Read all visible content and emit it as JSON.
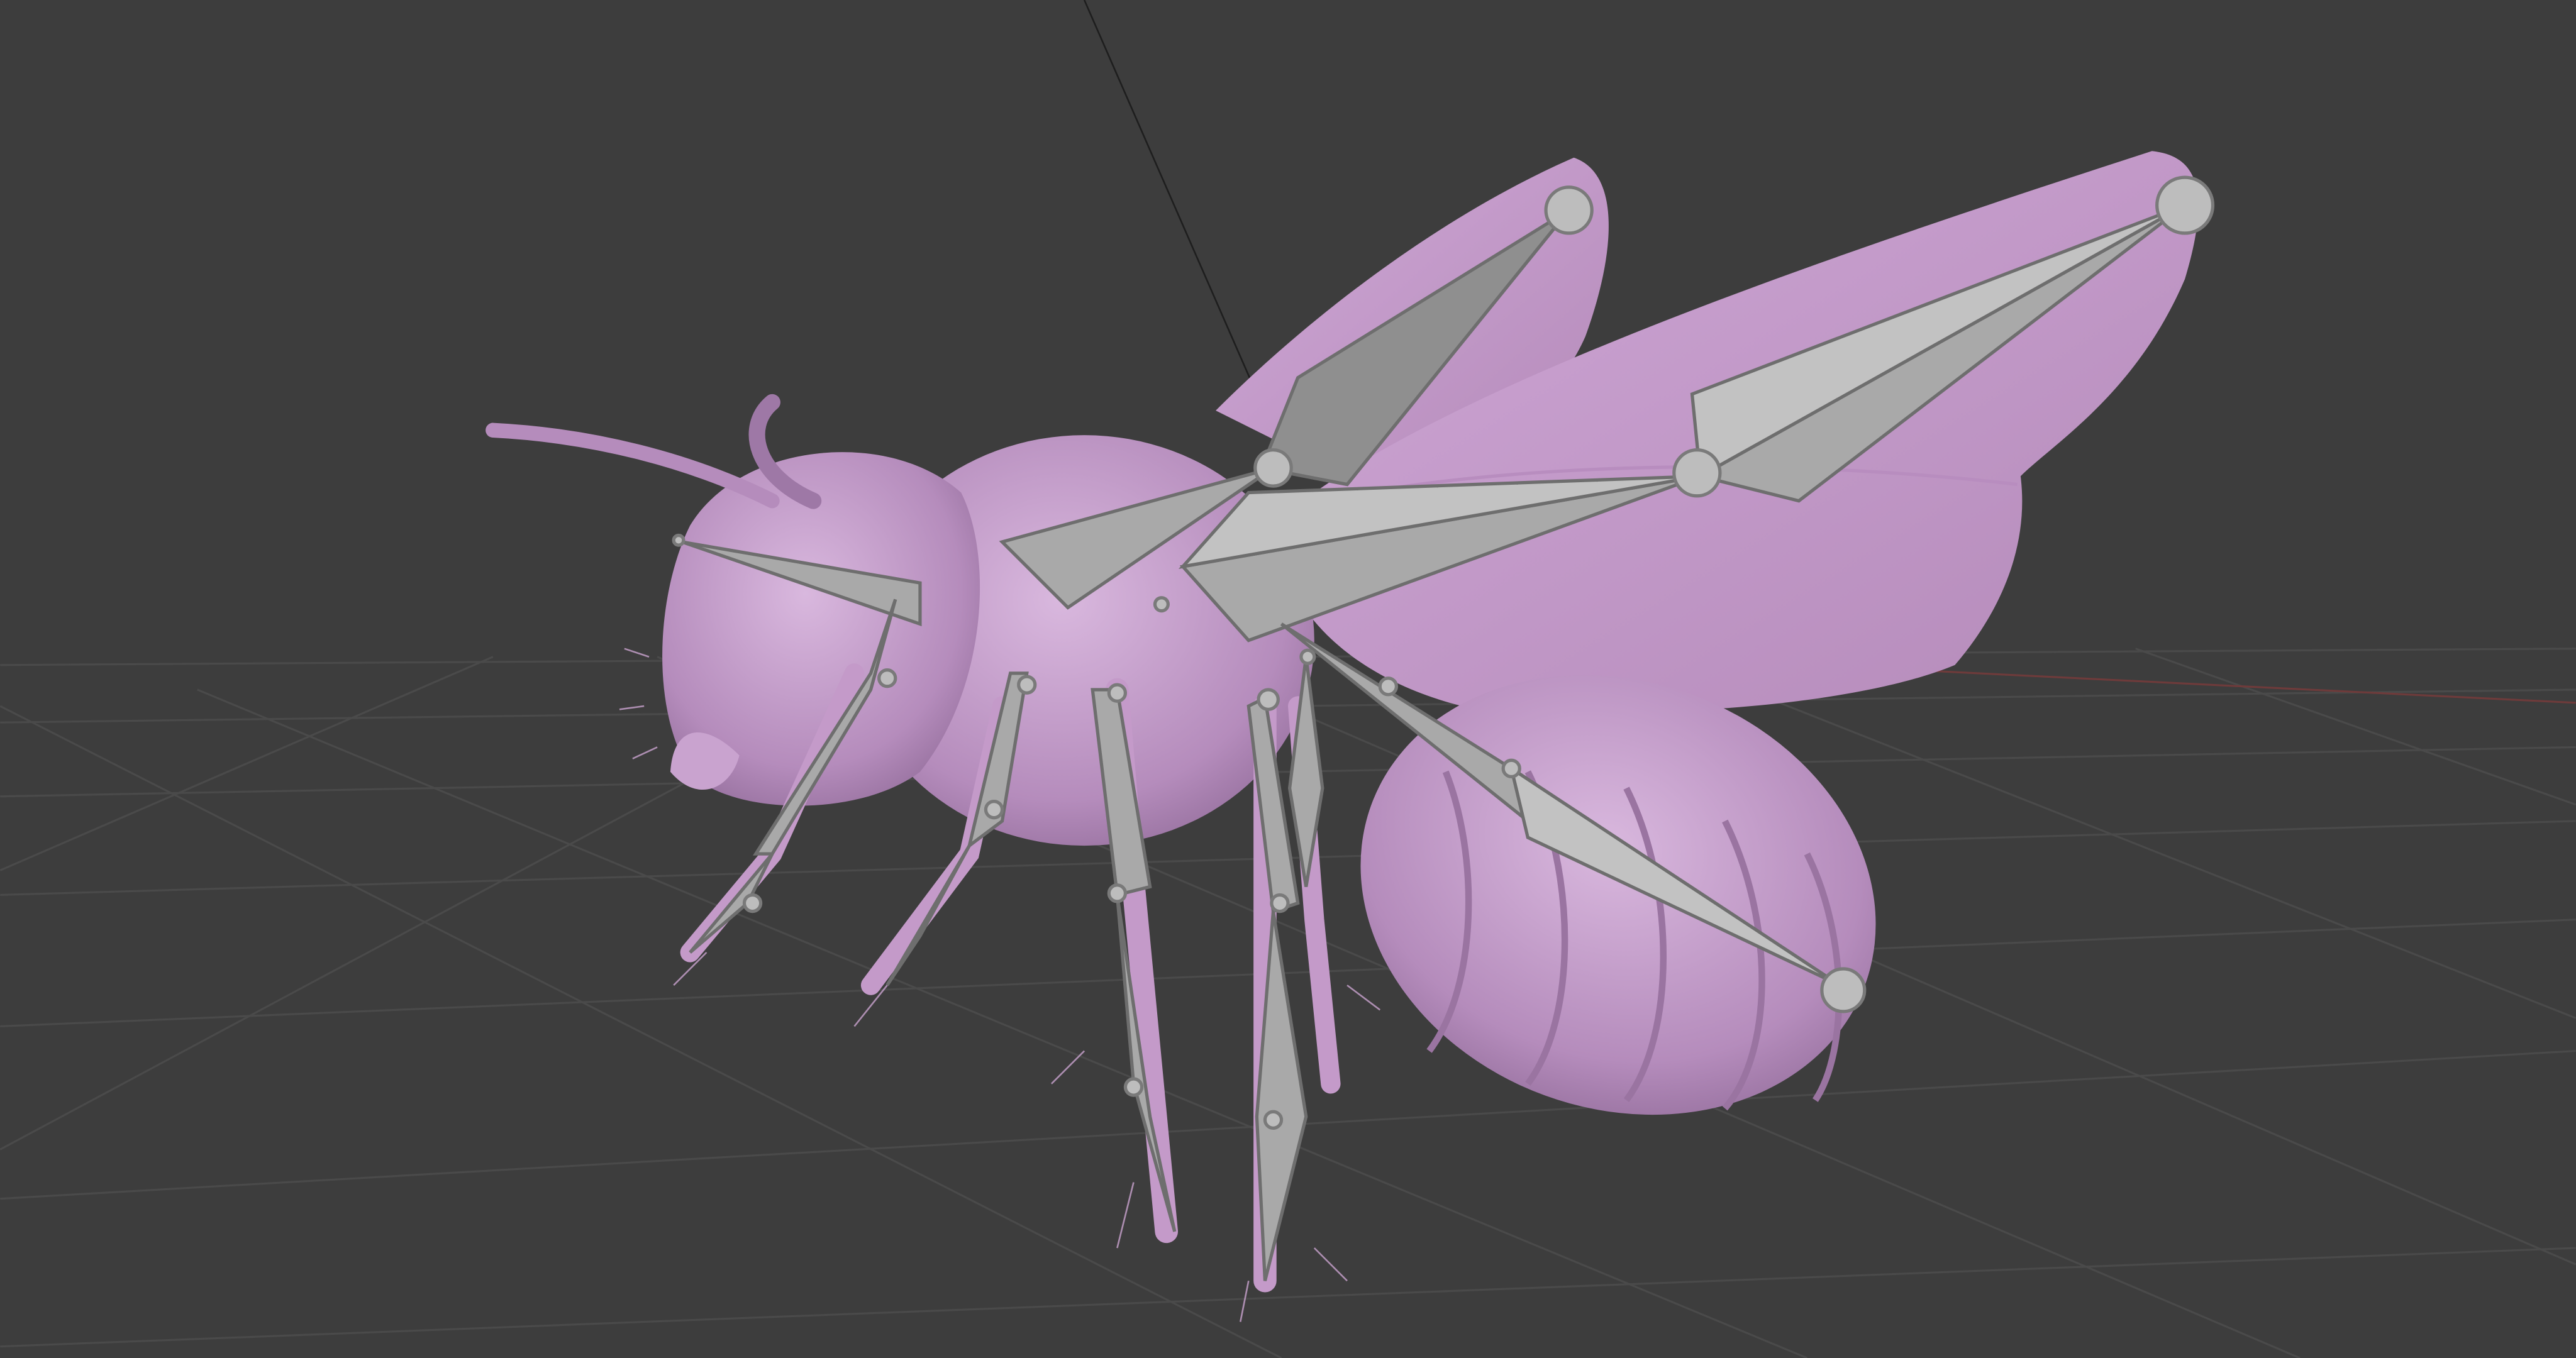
{
  "viewport": {
    "background_color": "#3d3d3d",
    "grid_color": "#505050",
    "x_axis_color": "#7a3a3a",
    "mesh_color": "#c49ac9",
    "armature_color": "#a9a9a9"
  }
}
